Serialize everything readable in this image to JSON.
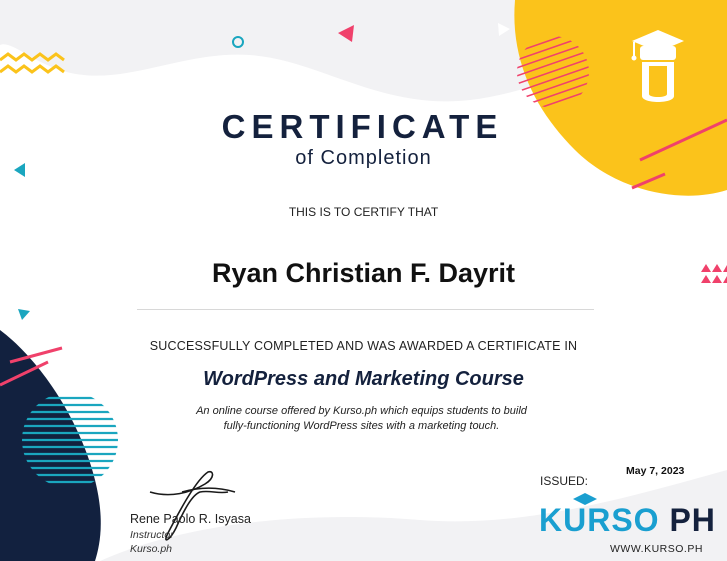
{
  "certificate": {
    "title": "CERTIFICATE",
    "subtitle": "of Completion",
    "certify_text": "THIS IS TO CERTIFY THAT",
    "recipient_name": "Ryan Christian F. Dayrit",
    "completed_text": "SUCCESSFULLY COMPLETED AND WAS AWARDED A CERTIFICATE IN",
    "course_name": "WordPress and Marketing Course",
    "description_line1": "An online course offered by Kurso.ph which equips students to build",
    "description_line2": "fully-functioning WordPress sites with a marketing touch."
  },
  "signatory": {
    "name": "Rene Paolo R. Isyasa",
    "role": "Instructor",
    "organization": "Kurso.ph"
  },
  "issue": {
    "label": "ISSUED:",
    "date": "May 7, 2023"
  },
  "brand": {
    "name_part1": "KURSO",
    "name_part2": " PH",
    "website": "WWW.KURSO.PH",
    "accent_color": "#1a9fd0",
    "dark_color": "#14213d"
  },
  "decoration_colors": {
    "yellow": "#fbc31b",
    "navy": "#12213f",
    "coral": "#f0416b",
    "teal": "#1aa6bf"
  }
}
